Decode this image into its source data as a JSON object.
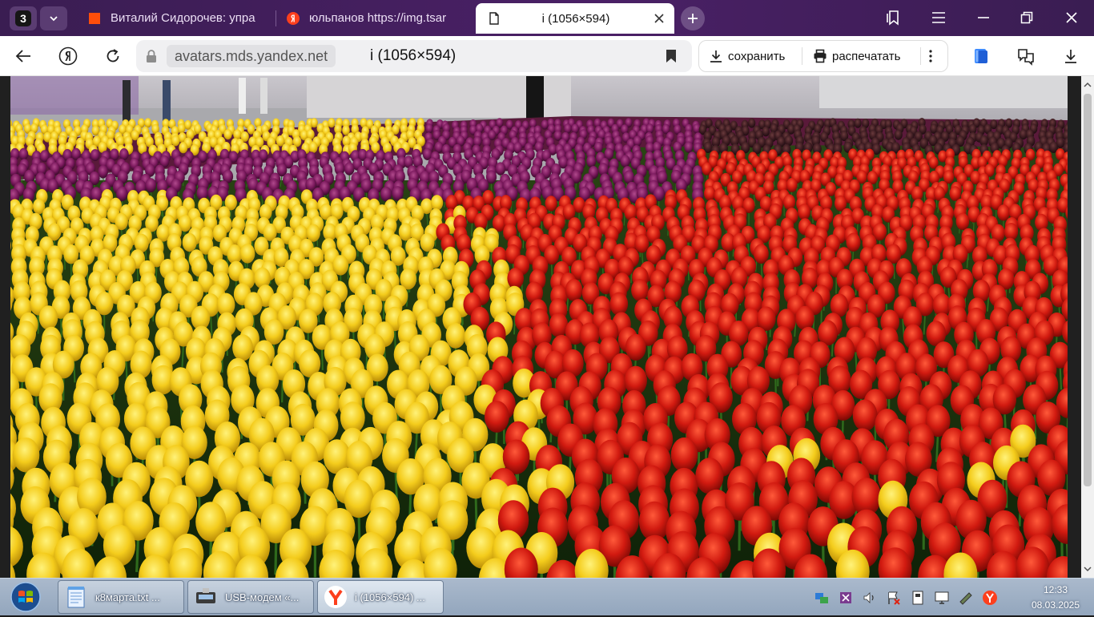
{
  "browser": {
    "tab_count": "3",
    "tabs": [
      {
        "label": "Виталий Сидорочев: упра"
      },
      {
        "label": "юльпанов https://img.tsar"
      },
      {
        "label": "i (1056×594)"
      }
    ],
    "address": {
      "domain": "avatars.mds.yandex.net",
      "title": "i (1056×594)"
    },
    "actions": {
      "save_label": "сохранить",
      "print_label": "распечатать"
    },
    "accent_color": "#3d1f55"
  },
  "taskbar": {
    "tasks": [
      {
        "label": "к8марта.txt ..."
      },
      {
        "label": "USB-модем «..."
      },
      {
        "label": "i (1056×594) ..."
      }
    ],
    "clock": {
      "time": "12:33",
      "date": "08.03.2025"
    }
  }
}
